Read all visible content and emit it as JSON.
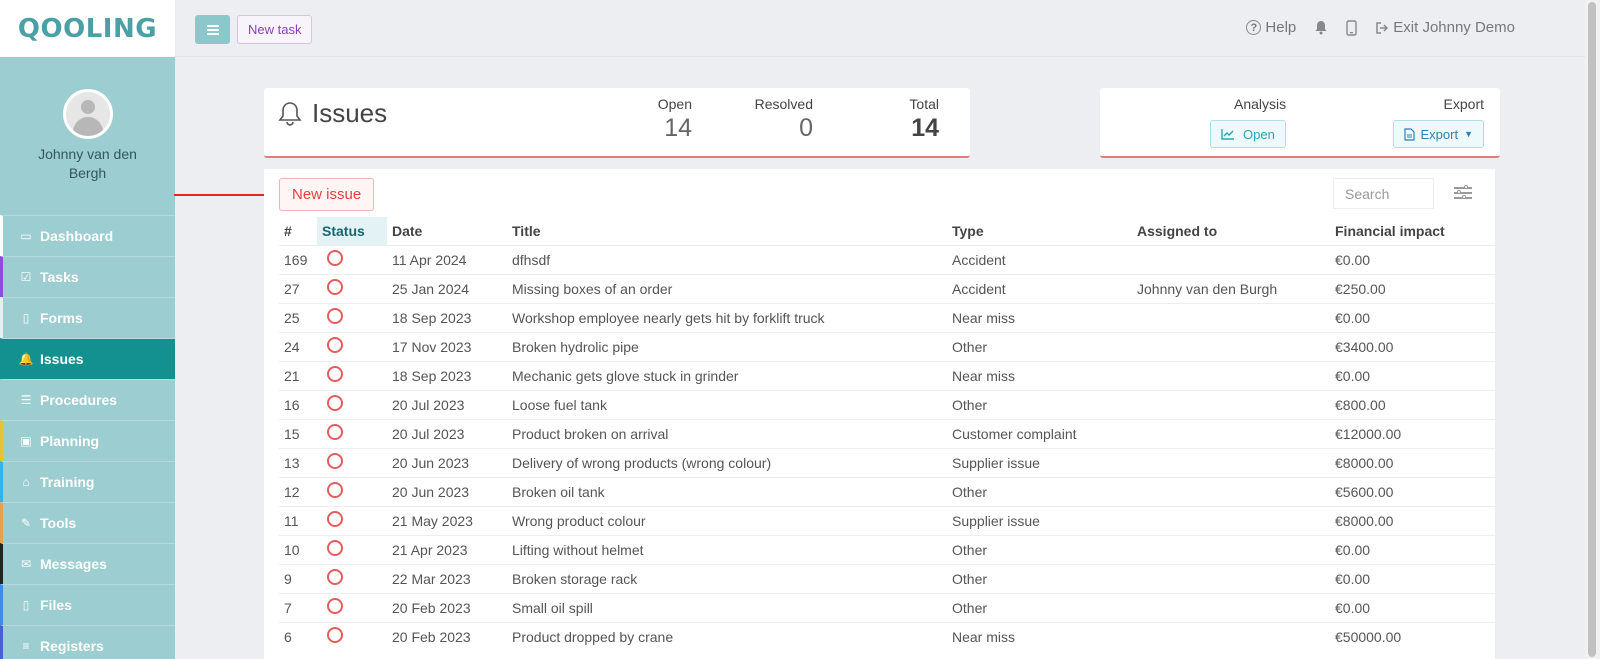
{
  "app": {
    "logo": "QOOLING"
  },
  "user": {
    "name": "Johnny van den Bergh"
  },
  "sidebar": {
    "items": [
      {
        "label": "Dashboard",
        "icon": "desktop-icon",
        "glyph": "▭",
        "accent": "#ffffff"
      },
      {
        "label": "Tasks",
        "icon": "checkbox-icon",
        "glyph": "☑",
        "accent": "#8a4fd8"
      },
      {
        "label": "Forms",
        "icon": "file-icon",
        "glyph": "▯",
        "accent": "#e8eef2"
      },
      {
        "label": "Issues",
        "icon": "bell-icon",
        "glyph": "🔔",
        "accent": "#139191",
        "active": true
      },
      {
        "label": "Procedures",
        "icon": "list-icon",
        "glyph": "☰",
        "accent": "#9ccdd0"
      },
      {
        "label": "Planning",
        "icon": "calendar-icon",
        "glyph": "▣",
        "accent": "#e0c43a"
      },
      {
        "label": "Training",
        "icon": "graduation-cap-icon",
        "glyph": "⌂",
        "accent": "#35b3e6"
      },
      {
        "label": "Tools",
        "icon": "wrench-icon",
        "glyph": "✎",
        "accent": "#e8a04a"
      },
      {
        "label": "Messages",
        "icon": "envelope-icon",
        "glyph": "✉",
        "accent": "#222222"
      },
      {
        "label": "Files",
        "icon": "pdf-file-icon",
        "glyph": "▯",
        "accent": "#3a8fe0"
      },
      {
        "label": "Registers",
        "icon": "list-lines-icon",
        "glyph": "≡",
        "accent": "#4a5fd0"
      }
    ]
  },
  "topbar": {
    "new_task_label": "New task",
    "help_label": "Help",
    "exit_label": "Exit Johnny Demo"
  },
  "summary": {
    "title": "Issues",
    "open_label": "Open",
    "open_value": "14",
    "resolved_label": "Resolved",
    "resolved_value": "0",
    "total_label": "Total",
    "total_value": "14"
  },
  "tools": {
    "analysis_label": "Analysis",
    "open_button": "Open",
    "export_label": "Export",
    "export_button": "Export"
  },
  "list": {
    "new_issue_label": "New issue",
    "search_placeholder": "Search",
    "columns": [
      "#",
      "Status",
      "Date",
      "Title",
      "Type",
      "Assigned to",
      "Financial impact"
    ],
    "rows": [
      {
        "id": "169",
        "date": "11 Apr 2024",
        "title": "dfhsdf",
        "type": "Accident",
        "assigned": "",
        "impact": "€0.00"
      },
      {
        "id": "27",
        "date": "25 Jan 2024",
        "title": "Missing boxes of an order",
        "type": "Accident",
        "assigned": "Johnny van den Burgh",
        "impact": "€250.00"
      },
      {
        "id": "25",
        "date": "18 Sep 2023",
        "title": "Workshop employee nearly gets hit by forklift truck",
        "type": "Near miss",
        "assigned": "",
        "impact": "€0.00"
      },
      {
        "id": "24",
        "date": "17 Nov 2023",
        "title": "Broken hydrolic pipe",
        "type": "Other",
        "assigned": "",
        "impact": "€3400.00"
      },
      {
        "id": "21",
        "date": "18 Sep 2023",
        "title": "Mechanic gets glove stuck in grinder",
        "type": "Near miss",
        "assigned": "",
        "impact": "€0.00"
      },
      {
        "id": "16",
        "date": "20 Jul 2023",
        "title": "Loose fuel tank",
        "type": "Other",
        "assigned": "",
        "impact": "€800.00"
      },
      {
        "id": "15",
        "date": "20 Jul 2023",
        "title": "Product broken on arrival",
        "type": "Customer complaint",
        "assigned": "",
        "impact": "€12000.00"
      },
      {
        "id": "13",
        "date": "20 Jun 2023",
        "title": "Delivery of wrong products (wrong colour)",
        "type": "Supplier issue",
        "assigned": "",
        "impact": "€8000.00"
      },
      {
        "id": "12",
        "date": "20 Jun 2023",
        "title": "Broken oil tank",
        "type": "Other",
        "assigned": "",
        "impact": "€5600.00"
      },
      {
        "id": "11",
        "date": "21 May 2023",
        "title": "Wrong product colour",
        "type": "Supplier issue",
        "assigned": "",
        "impact": "€8000.00"
      },
      {
        "id": "10",
        "date": "21 Apr 2023",
        "title": "Lifting without helmet",
        "type": "Other",
        "assigned": "",
        "impact": "€0.00"
      },
      {
        "id": "9",
        "date": "22 Mar 2023",
        "title": "Broken storage rack",
        "type": "Other",
        "assigned": "",
        "impact": "€0.00"
      },
      {
        "id": "7",
        "date": "20 Feb 2023",
        "title": "Small oil spill",
        "type": "Other",
        "assigned": "",
        "impact": "€0.00"
      },
      {
        "id": "6",
        "date": "20 Feb 2023",
        "title": "Product dropped by crane",
        "type": "Near miss",
        "assigned": "",
        "impact": "€50000.00"
      }
    ]
  },
  "colors": {
    "brand": "#4aa0a4",
    "sidebar": "#9ccdd0",
    "active": "#139191",
    "issue_accent": "#e64040"
  }
}
